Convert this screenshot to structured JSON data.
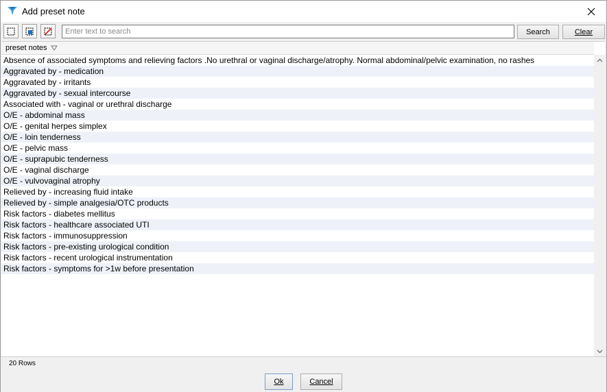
{
  "window": {
    "title": "Add preset note",
    "close_icon": "close-icon",
    "app_icon": "app-logo-icon"
  },
  "toolbar": {
    "tools": [
      "select-all-icon",
      "select-checked-icon",
      "clear-selection-icon"
    ],
    "search_placeholder": "Enter text to search",
    "search_value": "",
    "search_label": "Search",
    "clear_label": "Clear"
  },
  "grid": {
    "column_header": "preset notes",
    "filter_icon": "filter-icon",
    "rows": [
      "Absence of associated symptoms and relieving factors .No urethral or vaginal discharge/atrophy. Normal abdominal/pelvic examination, no rashes",
      "Aggravated by - medication",
      "Aggravated by - irritants",
      "Aggravated by - sexual intercourse",
      "Associated with - vaginal or urethral discharge",
      "O/E - abdominal mass",
      "O/E - genital herpes simplex",
      "O/E - loin tenderness",
      "O/E - pelvic mass",
      "O/E - suprapubic tenderness",
      "O/E - vaginal discharge",
      "O/E - vulvovaginal atrophy",
      "Relieved by - increasing fluid intake",
      "Relieved by - simple analgesia/OTC products",
      "Risk factors - diabetes mellitus",
      "Risk factors - healthcare associated UTI",
      "Risk factors - immunosuppression",
      "Risk factors - pre-existing urological condition",
      "Risk factors - recent urological instrumentation",
      "Risk factors - symptoms for >1w before presentation"
    ],
    "row_count_label": "20 Rows"
  },
  "footer": {
    "ok_label": "Ok",
    "cancel_label": "Cancel"
  },
  "colors": {
    "row_alt": "#eef2f8",
    "dialog_bg": "#f0f0f0",
    "icon_blue": "#1e6fbf",
    "icon_red": "#d02020"
  }
}
